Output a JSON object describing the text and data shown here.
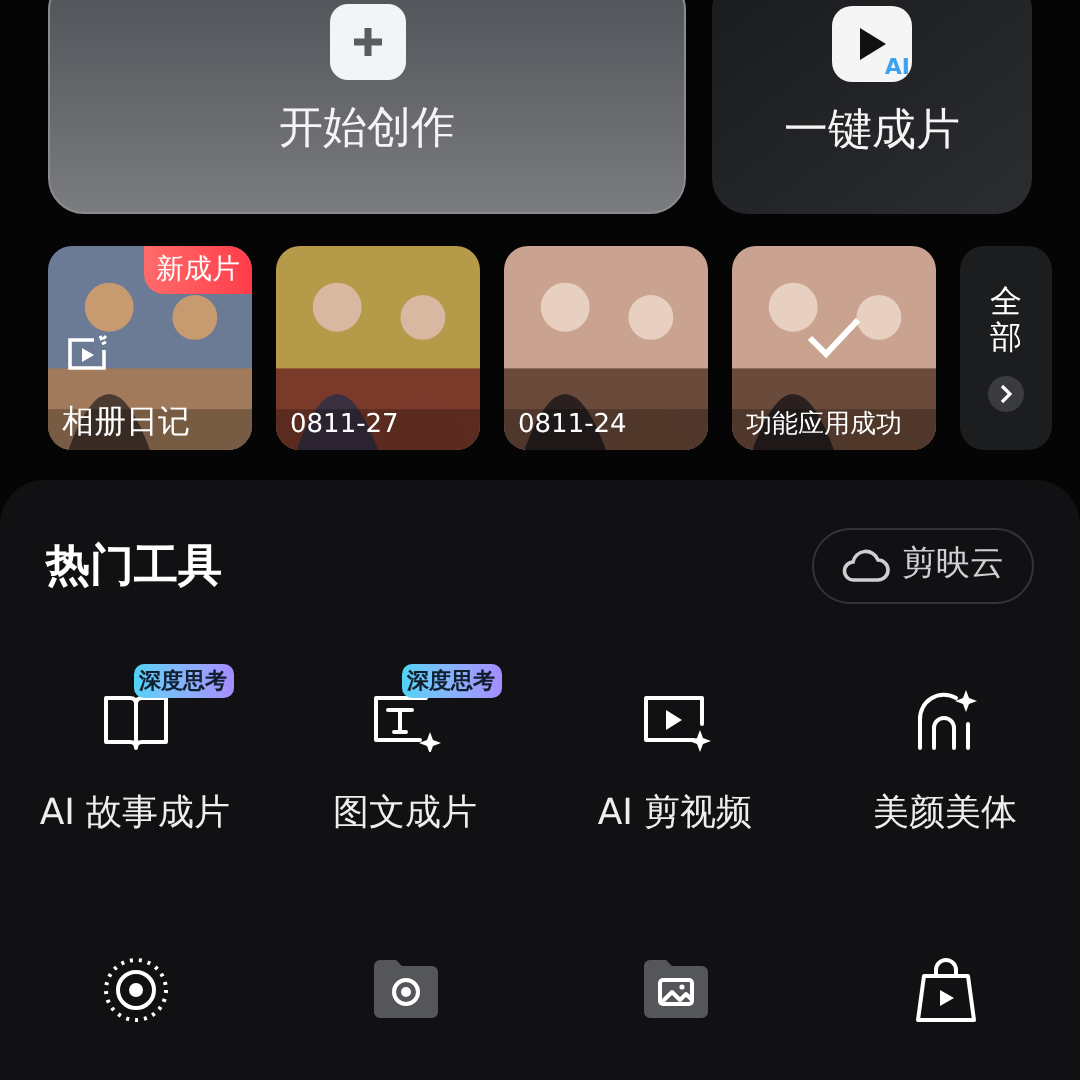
{
  "create_cards": [
    {
      "kind": "create",
      "label": "开始创作"
    },
    {
      "kind": "ai",
      "label": "一键成片",
      "badge": "AI"
    }
  ],
  "drafts": [
    {
      "kind": "album",
      "label": "相册日记",
      "badge": "新成片"
    },
    {
      "kind": "draft",
      "label": "0811-27"
    },
    {
      "kind": "draft",
      "label": "0811-24"
    },
    {
      "kind": "done",
      "label": "功能应用成功"
    }
  ],
  "all_button": {
    "label": "全部"
  },
  "tools_section": {
    "title": "热门工具",
    "cloud_button": "剪映云"
  },
  "tools": [
    {
      "label": "AI 故事成片",
      "badge": "深度思考"
    },
    {
      "label": "图文成片",
      "badge": "深度思考"
    },
    {
      "label": "AI 剪视频"
    },
    {
      "label": "美颜美体"
    }
  ]
}
